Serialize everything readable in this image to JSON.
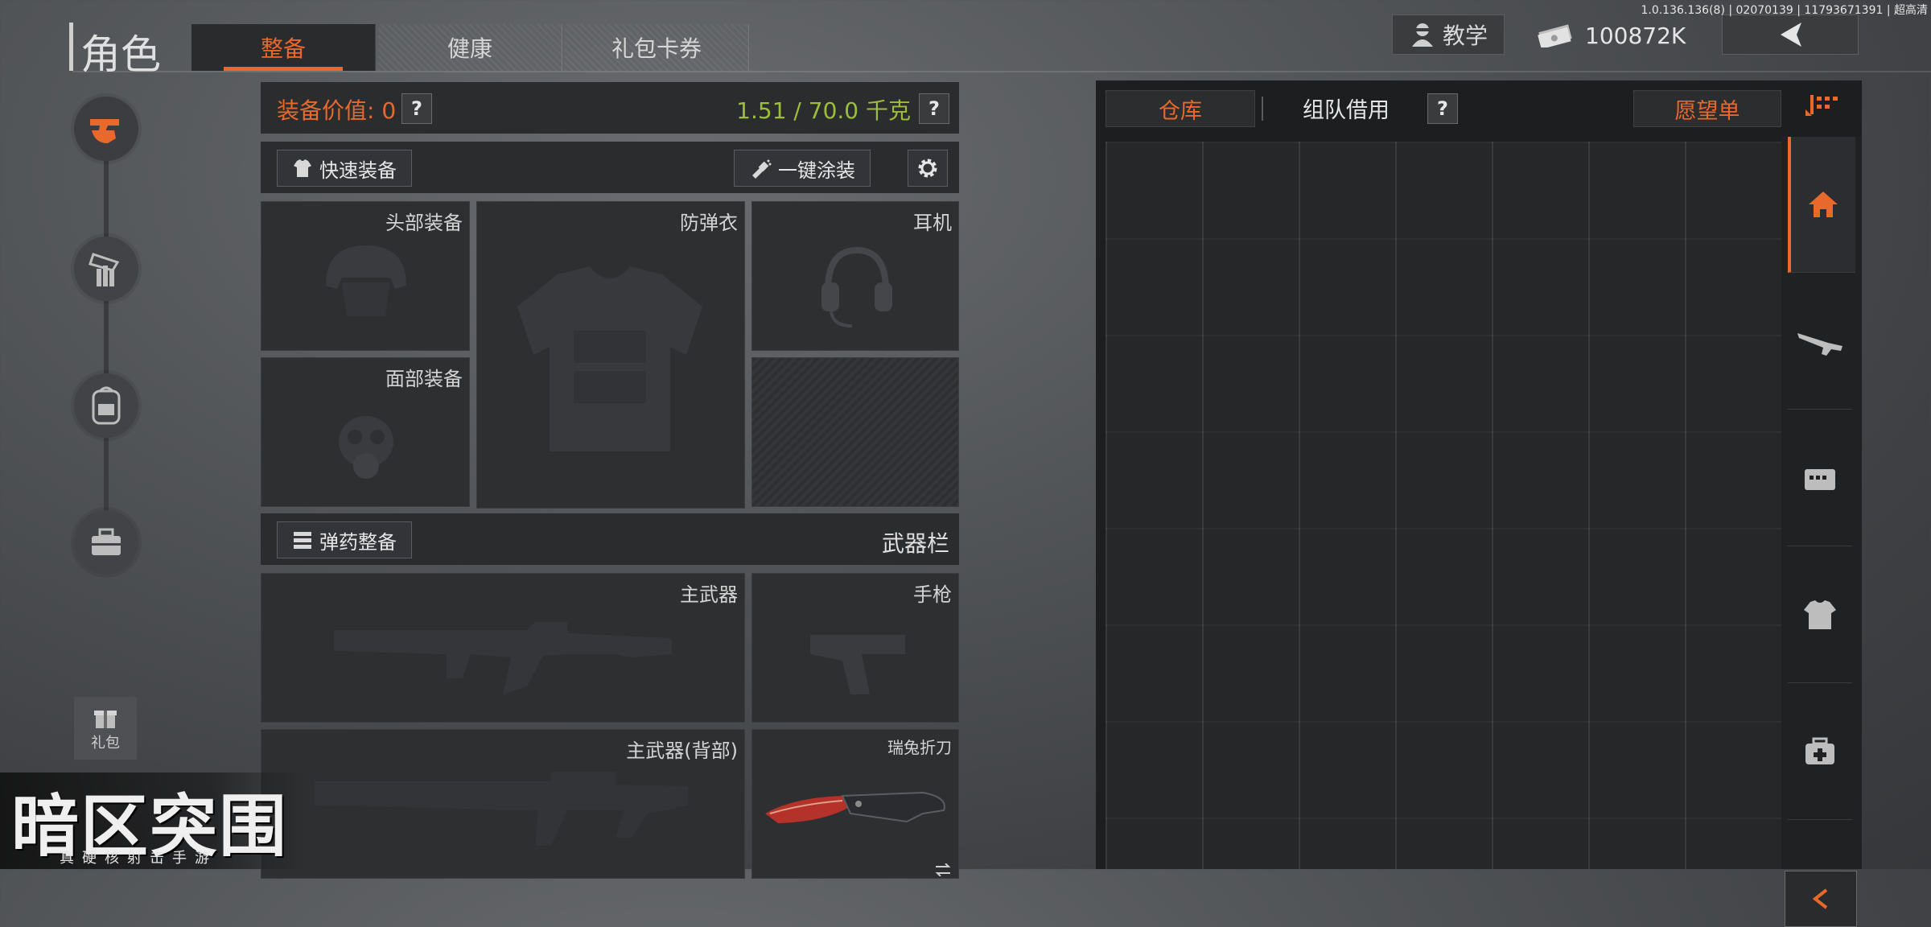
{
  "version_text": "1.0.136.136(8) | 02070139 | 11793671391 | 超高清",
  "header": {
    "title": "角色",
    "tabs": [
      {
        "label": "整备",
        "active": true
      },
      {
        "label": "健康",
        "active": false
      },
      {
        "label": "礼包卡券",
        "active": false
      }
    ],
    "tutorial_label": "教学",
    "currency_value": "100872K"
  },
  "left_rail": {
    "items": [
      "gun-hand-icon",
      "ammo-icon",
      "backpack-icon",
      "toolbox-icon"
    ],
    "gift_label": "礼包"
  },
  "equipment": {
    "value_label": "装备价值:",
    "value_amount": "0",
    "weight": "1.51 / 70.0 千克",
    "quick_equip": "快速装备",
    "one_click_paint": "一键涂装",
    "slots": {
      "head": "头部装备",
      "armor": "防弹衣",
      "headset": "耳机",
      "face": "面部装备"
    },
    "ammo_button": "弹药整备",
    "weapon_bar_label": "武器栏",
    "weapon_slots": {
      "primary": "主武器",
      "pistol": "手枪",
      "primary_back": "主武器(背部)",
      "knife": "瑞兔折刀"
    }
  },
  "warehouse": {
    "tab_storage": "仓库",
    "tab_team": "组队借用",
    "wishlist": "愿望单",
    "side_items": [
      "home-icon",
      "rifle-icon",
      "ammo-box-icon",
      "shirt-icon",
      "medkit-icon"
    ]
  },
  "logo": {
    "main": "暗区突围",
    "sub": "真硬核射击手游"
  },
  "colors": {
    "accent": "#e8692b",
    "weight_green": "#9cbe3a",
    "panel": "#2b2c2e"
  }
}
